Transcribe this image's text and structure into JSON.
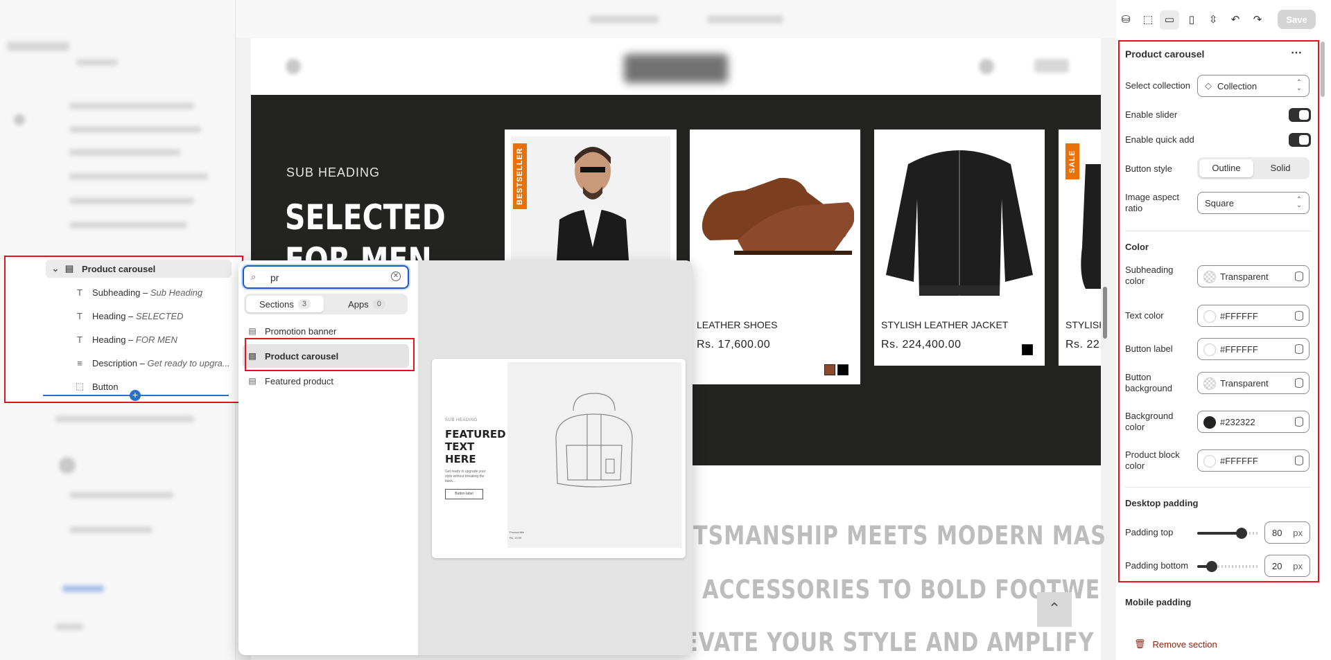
{
  "toolbar": {
    "save_label": "Save"
  },
  "tree": {
    "parent_label": "Product carousel",
    "children": [
      {
        "type": "Subheading",
        "value": "Sub Heading"
      },
      {
        "type": "Heading",
        "value": "SELECTED"
      },
      {
        "type": "Heading",
        "value": "FOR MEN"
      },
      {
        "type": "Description",
        "value": "Get ready to upgra..."
      },
      {
        "type": "Button",
        "value": ""
      }
    ],
    "separator": " – "
  },
  "picker": {
    "search_value": "pr",
    "tabs": [
      {
        "label": "Sections",
        "count": "3"
      },
      {
        "label": "Apps",
        "count": "0"
      }
    ],
    "items": [
      "Promotion banner",
      "Product carousel",
      "Featured product"
    ],
    "selected_item": "Product carousel",
    "preview": {
      "sub_heading": "SUB HEADING",
      "heading": "FEATURED TEXT HERE",
      "description": "Get ready to upgrade your style without breaking the bank...",
      "button_label": "Button label",
      "product_title": "Product title",
      "product_price": "Rs. 19.99"
    }
  },
  "hero": {
    "sub_heading": "SUB HEADING",
    "heading": "SELECTED FOR MEN",
    "products": [
      {
        "title": "",
        "price": "",
        "badge": "BESTSELLER",
        "badge_color": "#e8710a"
      },
      {
        "title": "LEATHER SHOES",
        "price": "Rs. 17,600.00",
        "badge": "",
        "swatches": [
          "#8b4a2b",
          "#000000"
        ]
      },
      {
        "title": "STYLISH LEATHER JACKET",
        "price": "Rs. 224,400.00",
        "badge": "",
        "swatches": [
          "#000000"
        ]
      },
      {
        "title": "STYLISH",
        "price": "Rs. 22",
        "badge": "SALE",
        "badge_color": "#e8710a"
      }
    ],
    "background": "#232322"
  },
  "band": {
    "lines": [
      "TSMANSHIP MEETS MODERN MAS",
      "ACCESSORIES TO BOLD FOOTWE",
      "EVATE YOUR STYLE AND AMPLIFY"
    ]
  },
  "settings": {
    "title": "Product carousel",
    "select_collection_label": "Select collection",
    "select_collection_value": "Collection",
    "enable_slider_label": "Enable slider",
    "enable_slider": true,
    "enable_quick_add_label": "Enable quick add",
    "enable_quick_add": true,
    "button_style_label": "Button style",
    "button_style_options": [
      "Outline",
      "Solid"
    ],
    "button_style_selected": "Outline",
    "image_aspect_label": "Image aspect ratio",
    "image_aspect_value": "Square",
    "color_heading": "Color",
    "colors": [
      {
        "label": "Subheading color",
        "value": "Transparent",
        "swatch": "transparent"
      },
      {
        "label": "Text color",
        "value": "#FFFFFF",
        "swatch": "#FFFFFF"
      },
      {
        "label": "Button label",
        "value": "#FFFFFF",
        "swatch": "#FFFFFF"
      },
      {
        "label": "Button background",
        "value": "Transparent",
        "swatch": "transparent"
      },
      {
        "label": "Background color",
        "value": "#232322",
        "swatch": "#232322"
      },
      {
        "label": "Product block color",
        "value": "#FFFFFF",
        "swatch": "#FFFFFF"
      }
    ],
    "desktop_padding_heading": "Desktop padding",
    "padding_top_label": "Padding top",
    "padding_top_value": "80",
    "padding_bottom_label": "Padding bottom",
    "padding_bottom_value": "20",
    "padding_unit": "px",
    "mobile_padding_heading": "Mobile padding",
    "remove_section_label": "Remove section"
  }
}
